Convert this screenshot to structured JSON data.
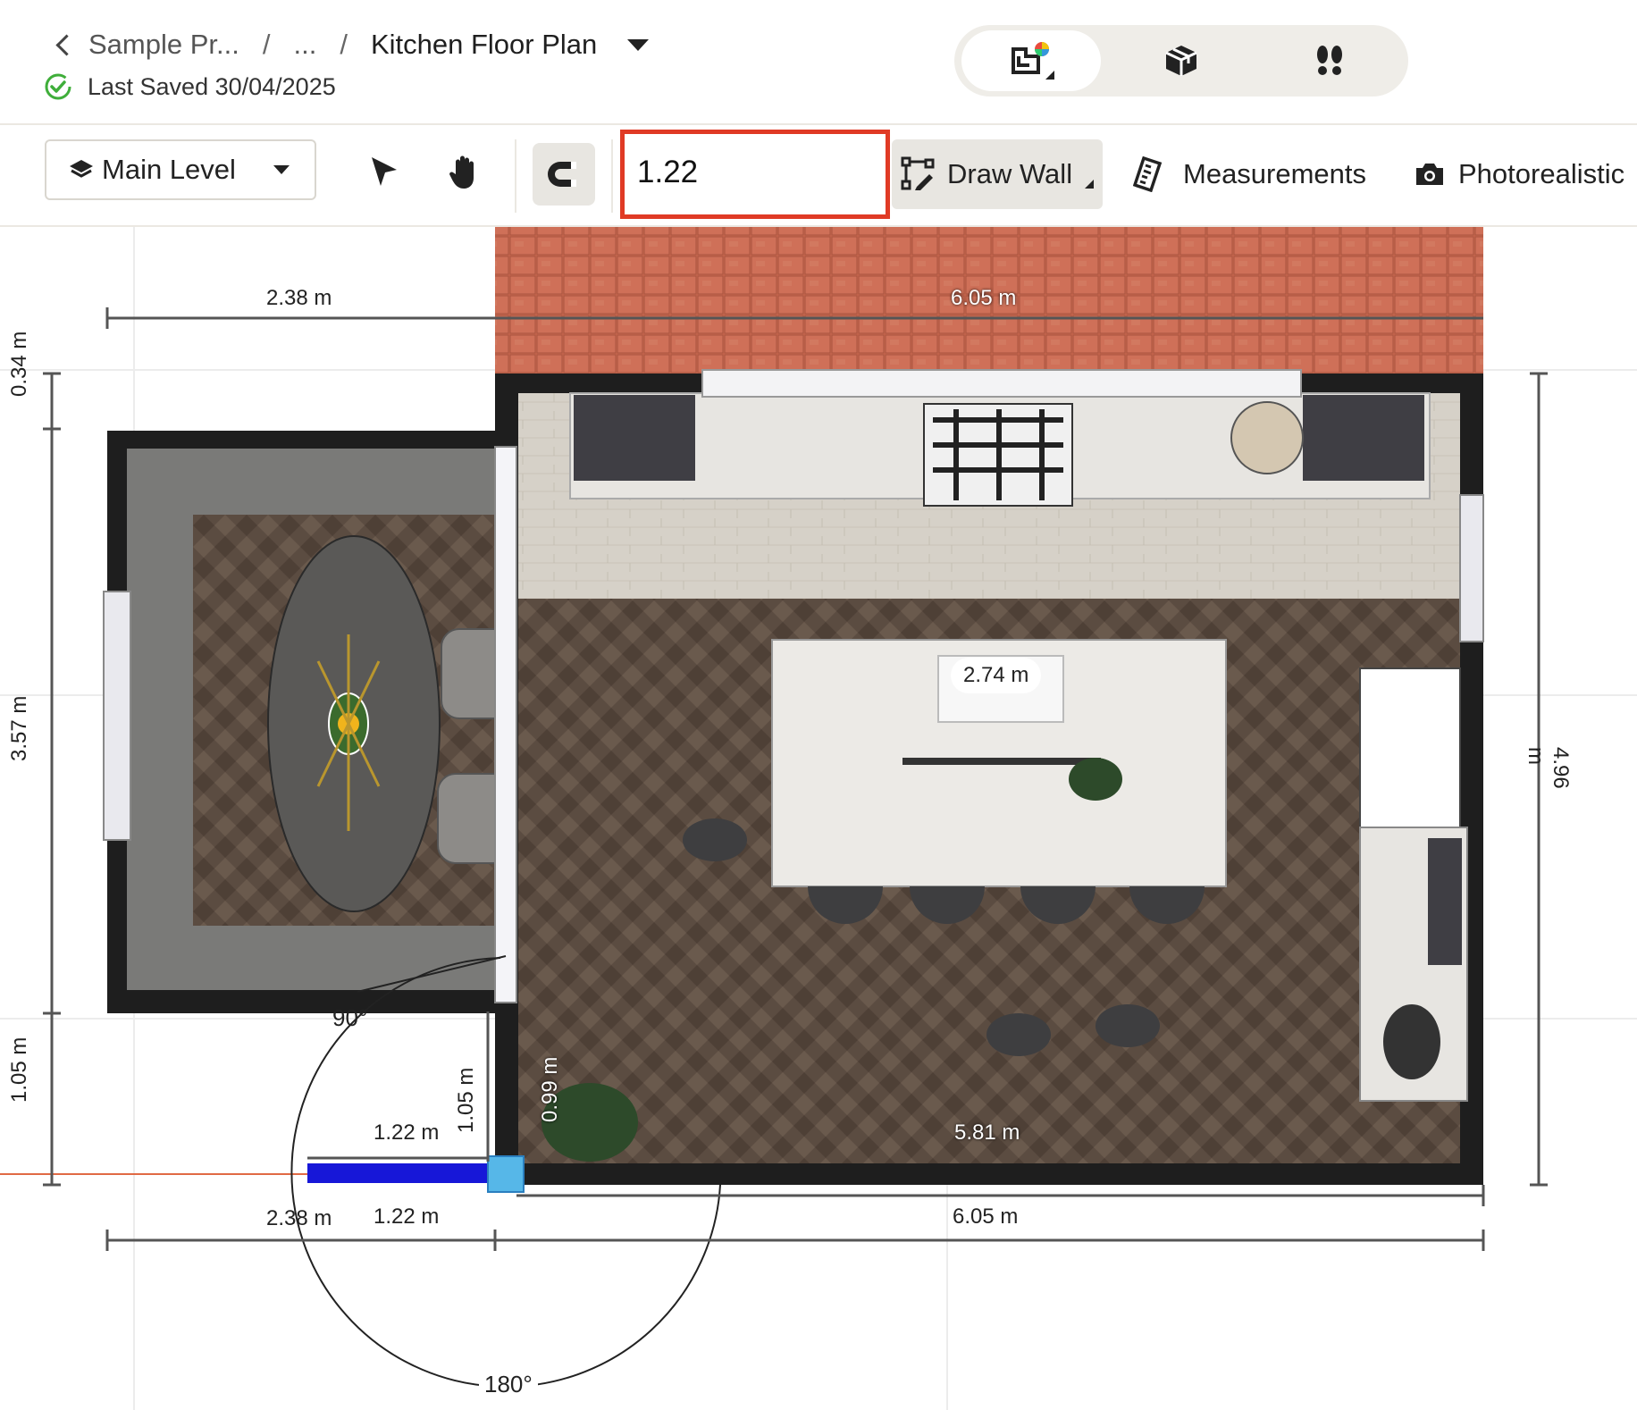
{
  "header": {
    "back_label": "Sample Pr...",
    "ellipsis": "...",
    "sep1": "/",
    "sep2": "/",
    "title": "Kitchen Floor Plan",
    "saved_text": "Last Saved 30/04/2025"
  },
  "view_switch": {
    "items": [
      {
        "name": "2d-plan-view",
        "icon": "floor-plan-icon",
        "active": true
      },
      {
        "name": "3d-view",
        "icon": "cube-icon",
        "active": false
      },
      {
        "name": "walkthrough-view",
        "icon": "footprints-icon",
        "active": false
      }
    ]
  },
  "toolbar": {
    "level_label": "Main Level",
    "length_value": "1.22",
    "draw_wall_label": "Draw Wall",
    "measurements_label": "Measurements",
    "photorealistic_label": "Photorealistic"
  },
  "plan": {
    "dims": {
      "top_left": "2.38 m",
      "top_wall": "6.05 m",
      "left_034": "0.34 m",
      "left_357": "3.57 m",
      "left_105": "1.05 m",
      "right_496": "4.96 m",
      "island": "2.74 m",
      "inner_105": "1.05 m",
      "inner_099": "0.99 m",
      "wall_122_top": "1.22 m",
      "wall_122_bottom": "1.22 m",
      "bottom_238": "2.38 m",
      "bottom_605": "6.05 m",
      "bottom_581": "5.81 m",
      "angle_90": "90°",
      "angle_180": "180°"
    }
  },
  "colors": {
    "accent_red": "#e03a25",
    "wall_draw_blue": "#1717d8",
    "saved_green": "#3fae3a",
    "brick": "#c8674f",
    "wall_black": "#1e1e1e",
    "herringbone": "#5a4b40"
  }
}
